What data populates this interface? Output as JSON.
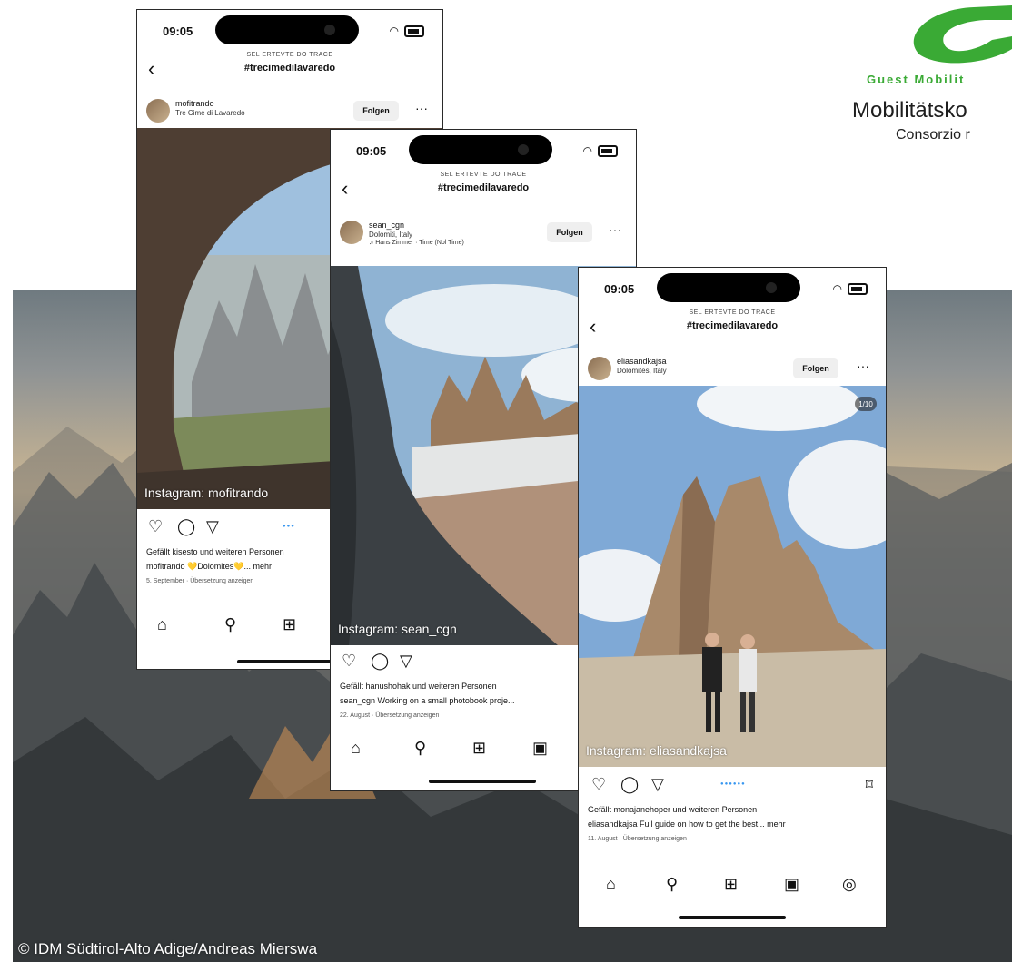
{
  "credit": "© IDM Südtirol-Alto Adige/Andreas Mierswa",
  "logo": {
    "line1": "Guest Mobilit",
    "line2": "Mobilitätsko",
    "line3": "Consorzio r"
  },
  "phones": [
    {
      "time": "09:05",
      "subheading": "SEL ERTEVTE DO TRACE",
      "hashtag": "#trecimedilavaredo",
      "username": "mofitrando",
      "location": "Tre Cime di Lavaredo",
      "follow_label": "Folgen",
      "overlay": "Instagram: mofitrando",
      "likes": "Gefällt kisesto und weiteren Personen",
      "caption": "mofitrando 💛Dolomites💛... mehr",
      "meta": "5. September · Übersetzung anzeigen"
    },
    {
      "time": "09:05",
      "subheading": "SEL ERTEVTE DO TRACE",
      "hashtag": "#trecimedilavaredo",
      "username": "sean_cgn",
      "location": "Dolomiti, Italy",
      "music": "♫ Hans Zimmer · Time (Nol Time)",
      "follow_label": "Folgen",
      "overlay": "Instagram: sean_cgn",
      "likes": "Gefällt hanushohak und weiteren Personen",
      "caption": "sean_cgn Working on a small photobook proje...",
      "meta": "22. August · Übersetzung anzeigen"
    },
    {
      "time": "09:05",
      "subheading": "SEL ERTEVTE DO TRACE",
      "hashtag": "#trecimedilavaredo",
      "username": "eliasandkajsa",
      "location": "Dolomites, Italy",
      "follow_label": "Folgen",
      "overlay": "Instagram: eliasandkajsa",
      "badge": "1/10",
      "likes": "Gefällt monajanehoper und weiteren Personen",
      "caption": "eliasandkajsa Full guide on how to get the best... mehr",
      "meta": "11. August · Übersetzung anzeigen"
    }
  ]
}
